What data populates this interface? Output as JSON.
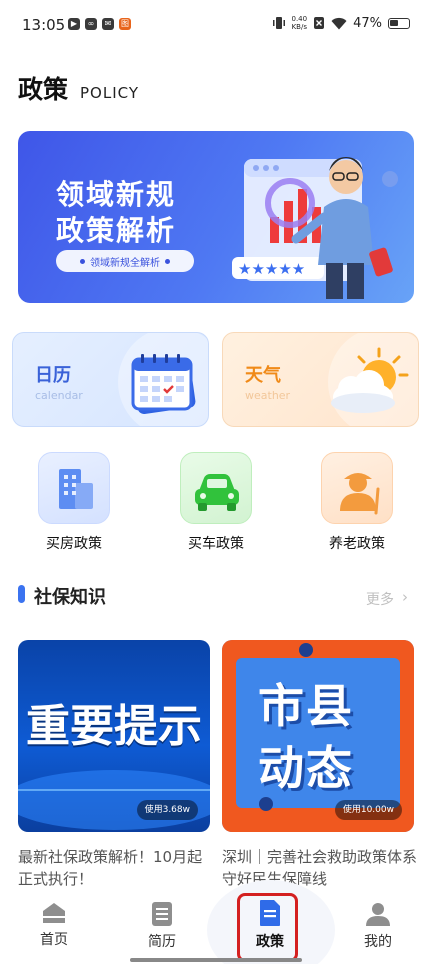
{
  "status_bar": {
    "time": "13:05",
    "notification_icons": [
      "▶",
      "∞",
      "✉",
      "图"
    ],
    "net_speed_value": "0.40",
    "net_speed_unit": "KB/s",
    "battery": "47%"
  },
  "header": {
    "title": "政策",
    "subtitle": "POLICY"
  },
  "banner": {
    "line1": "领域新规",
    "line2": "政策解析",
    "pill": "领域新规全解析"
  },
  "tools": [
    {
      "title": "日历",
      "subtitle": "calendar"
    },
    {
      "title": "天气",
      "subtitle": "weather"
    }
  ],
  "shortcuts": [
    {
      "label": "买房政策",
      "icon": "building-icon"
    },
    {
      "label": "买车政策",
      "icon": "car-icon"
    },
    {
      "label": "养老政策",
      "icon": "elderly-icon"
    }
  ],
  "section": {
    "title": "社保知识",
    "more": "更多",
    "more_chevron": "›"
  },
  "articles": [
    {
      "thumb_text": "重要提示",
      "usage": "使用3.68w",
      "title": "最新社保政策解析！10月起正式执行！"
    },
    {
      "thumb_text_1": "市县",
      "thumb_text_2": "动态",
      "usage": "使用10.00w",
      "title": "深圳｜完善社会救助政策体系 守好民生保障线"
    }
  ],
  "nav": [
    {
      "label": "首页",
      "icon": "home-icon"
    },
    {
      "label": "简历",
      "icon": "resume-icon"
    },
    {
      "label": "政策",
      "icon": "policy-doc-icon",
      "active": true
    },
    {
      "label": "我的",
      "icon": "profile-icon"
    }
  ],
  "colors": {
    "accent": "#3b73f0",
    "highlight_box": "#d42020",
    "weather_orange": "#f08a18"
  }
}
